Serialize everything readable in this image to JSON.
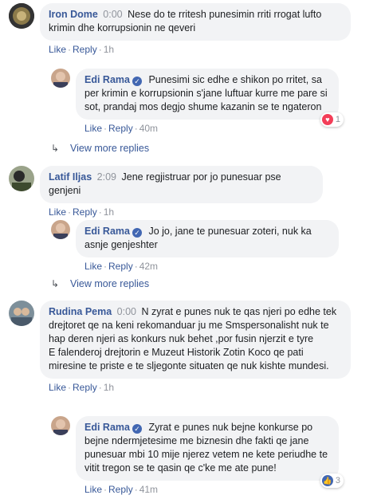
{
  "comments": [
    {
      "author": "Iron Dome",
      "time_inline": "0:00",
      "text": "Nese do te rritesh punesimin rriti rrogat lufto krimin dhe korrupsionin ne qeveri",
      "like": "Like",
      "reply": "Reply",
      "time": "1h",
      "reply_item": {
        "author": "Edi Rama",
        "text": "Punesimi sic edhe e shikon po rritet, sa per krimin e korrupsionin s'jane luftuar kurre me pare si sot, prandaj mos degjo shume kazanin se te ngateron",
        "like": "Like",
        "reply": "Reply",
        "time": "40m",
        "reaction_count": "1",
        "reaction_color": "#f33e58",
        "reaction_icon": "heart-icon"
      },
      "view_more": "View more replies"
    },
    {
      "author": "Latif Iljas",
      "time_inline": "2:09",
      "text": "Jene regjistruar por jo punesuar pse genjeni",
      "like": "Like",
      "reply": "Reply",
      "time": "1h",
      "reply_item": {
        "author": "Edi Rama",
        "text": "Jo jo, jane te punesuar zoteri, nuk ka asnje genjeshter",
        "like": "Like",
        "reply": "Reply",
        "time": "42m"
      },
      "view_more": "View more replies"
    },
    {
      "author": "Rudina Pema",
      "time_inline": "0:00",
      "text": "N zyrat e punes nuk te qas njeri po edhe tek drejtoret qe na keni rekomanduar ju me Smspersonalisht nuk te hap deren njeri as konkurs nuk behet ,por fusin njerzit e tyre",
      "text2": "E falenderoj drejtorin e Muzeut Historik Zotin Koco qe pati miresine te priste e te sljegonte situaten qe nuk kishte mundesi.",
      "like": "Like",
      "reply": "Reply",
      "time": "1h",
      "reply_item": {
        "author": "Edi Rama",
        "text": "Zyrat e punes nuk bejne konkurse po bejne ndermjetesime me biznesin dhe fakti qe jane punesuar mbi 10 mije njerez vetem ne kete periudhe te vitit tregon se te qasin qe c'ke me ate pune!",
        "like": "Like",
        "reply": "Reply",
        "time": "41m",
        "reaction_count": "3",
        "reaction_color": "#4267b2",
        "reaction_icon": "like-thumb-icon"
      }
    }
  ],
  "accent": "#385898"
}
